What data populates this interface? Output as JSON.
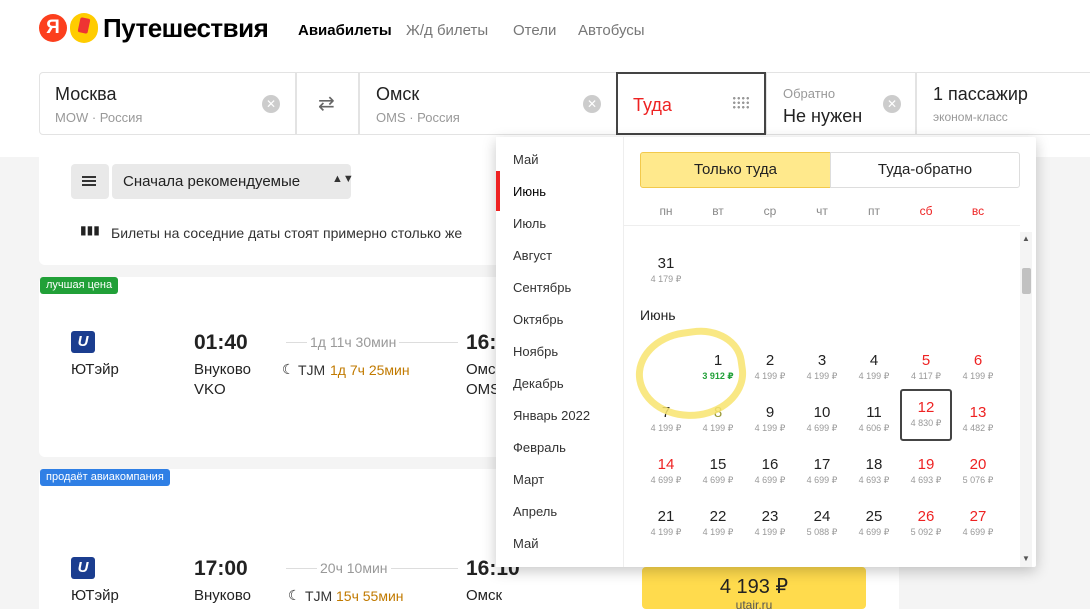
{
  "header": {
    "logo_letter": "Я",
    "logo_text": "Путешествия",
    "nav": [
      "Авиабилеты",
      "Ж/д билеты",
      "Отели",
      "Автобусы"
    ]
  },
  "search": {
    "from_city": "Москва",
    "from_sub": "MOW · Россия",
    "to_city": "Омск",
    "to_sub": "OMS · Россия",
    "depart_label": "Туда",
    "return_label": "Обратно",
    "return_value": "Не нужен",
    "passengers": "1 пассажир",
    "class": "эконом-класс"
  },
  "results": {
    "sort_label": "Сначала рекомендуемые",
    "prices_note": "Билеты на соседние даты стоят примерно столько же",
    "flights": [
      {
        "badge": "лучшая цена",
        "airline": "ЮТэйр",
        "dep_time": "01:40",
        "duration": "1д 11ч 30мин",
        "arr_time": "16:",
        "dep_airport": "Внуково",
        "dep_code": "VKO",
        "stop_code": "TJM",
        "stop_time": "1д 7ч 25мин",
        "arr_airport": "Омс",
        "arr_code": "OMS"
      },
      {
        "badge": "продаёт авиакомпания",
        "airline": "ЮТэйр",
        "dep_time": "17:00",
        "duration": "20ч 10мин",
        "arr_time": "16:10",
        "dep_airport": "Внуково",
        "stop_code": "TJM",
        "stop_time": "15ч 55мин",
        "arr_airport": "Омск",
        "price": "4 193 ₽",
        "seller": "utair.ru"
      }
    ]
  },
  "calendar": {
    "months": [
      "Май",
      "Июнь",
      "Июль",
      "Август",
      "Сентябрь",
      "Октябрь",
      "Ноябрь",
      "Декабрь",
      "Январь 2022",
      "Февраль",
      "Март",
      "Апрель",
      "Май"
    ],
    "active_month": "Июнь",
    "toggle_oneway": "Только туда",
    "toggle_roundtrip": "Туда-обратно",
    "weekdays": [
      "пн",
      "вт",
      "ср",
      "чт",
      "пт",
      "сб",
      "вс"
    ],
    "may_31": {
      "day": "31",
      "price": "4 179 ₽"
    },
    "june_label": "Июнь",
    "june_days": [
      {
        "d": "1",
        "p": "3 912 ₽"
      },
      {
        "d": "2",
        "p": "4 199 ₽"
      },
      {
        "d": "3",
        "p": "4 199 ₽"
      },
      {
        "d": "4",
        "p": "4 199 ₽"
      },
      {
        "d": "5",
        "p": "4 117 ₽"
      },
      {
        "d": "6",
        "p": "4 199 ₽"
      },
      {
        "d": "7",
        "p": "4 199 ₽"
      },
      {
        "d": "8",
        "p": "4 199 ₽"
      },
      {
        "d": "9",
        "p": "4 199 ₽"
      },
      {
        "d": "10",
        "p": "4 699 ₽"
      },
      {
        "d": "11",
        "p": "4 606 ₽"
      },
      {
        "d": "12",
        "p": "4 830 ₽"
      },
      {
        "d": "13",
        "p": "4 482 ₽"
      },
      {
        "d": "14",
        "p": "4 699 ₽"
      },
      {
        "d": "15",
        "p": "4 699 ₽"
      },
      {
        "d": "16",
        "p": "4 699 ₽"
      },
      {
        "d": "17",
        "p": "4 699 ₽"
      },
      {
        "d": "18",
        "p": "4 693 ₽"
      },
      {
        "d": "19",
        "p": "4 693 ₽"
      },
      {
        "d": "20",
        "p": "5 076 ₽"
      },
      {
        "d": "21",
        "p": "4 199 ₽"
      },
      {
        "d": "22",
        "p": "4 199 ₽"
      },
      {
        "d": "23",
        "p": "4 199 ₽"
      },
      {
        "d": "24",
        "p": "5 088 ₽"
      },
      {
        "d": "25",
        "p": "4 699 ₽"
      },
      {
        "d": "26",
        "p": "5 092 ₽"
      },
      {
        "d": "27",
        "p": "4 699 ₽"
      }
    ]
  },
  "colors": {
    "accent_red": "#e22222",
    "highlight_yellow": "#ffdb4d",
    "best_price_green": "#21a038",
    "airline_badge_blue": "#2f7fe5"
  }
}
